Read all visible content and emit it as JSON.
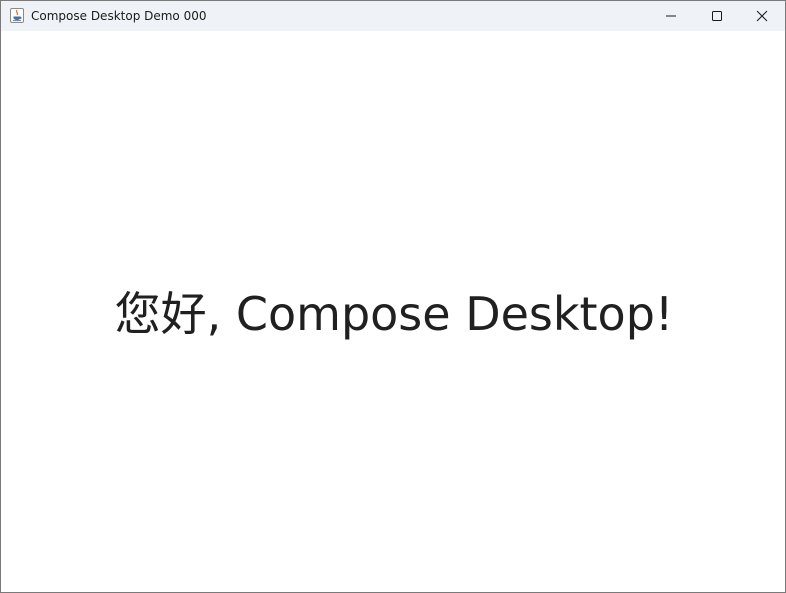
{
  "window": {
    "title": "Compose Desktop Demo 000",
    "app_icon": "java-icon",
    "controls": {
      "minimize_icon": "minimize-icon",
      "maximize_icon": "maximize-icon",
      "close_icon": "close-icon"
    }
  },
  "main": {
    "greeting": "您好, Compose Desktop!"
  },
  "colors": {
    "titlebar_bg": "#eff3f8",
    "content_bg": "#ffffff",
    "text": "#202020"
  }
}
